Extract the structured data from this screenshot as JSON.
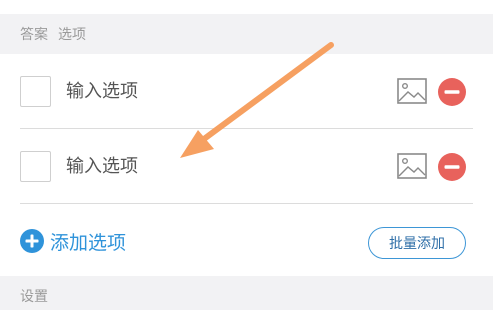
{
  "answers_header": {
    "label_answer": "答案",
    "label_options": "选项"
  },
  "options": [
    {
      "placeholder": "输入选项",
      "value": "",
      "image_icon": "image-icon",
      "remove_icon": "remove-icon"
    },
    {
      "placeholder": "输入选项",
      "value": "",
      "image_icon": "image-icon",
      "remove_icon": "remove-icon"
    }
  ],
  "add_option": {
    "label": "添加选项",
    "icon": "plus-circle-icon"
  },
  "batch_add": {
    "label": "批量添加"
  },
  "settings_header": {
    "label": "设置"
  },
  "colors": {
    "accent_blue": "#2f93da",
    "remove_red": "#e8625c",
    "arrow_orange": "#f6a061"
  }
}
